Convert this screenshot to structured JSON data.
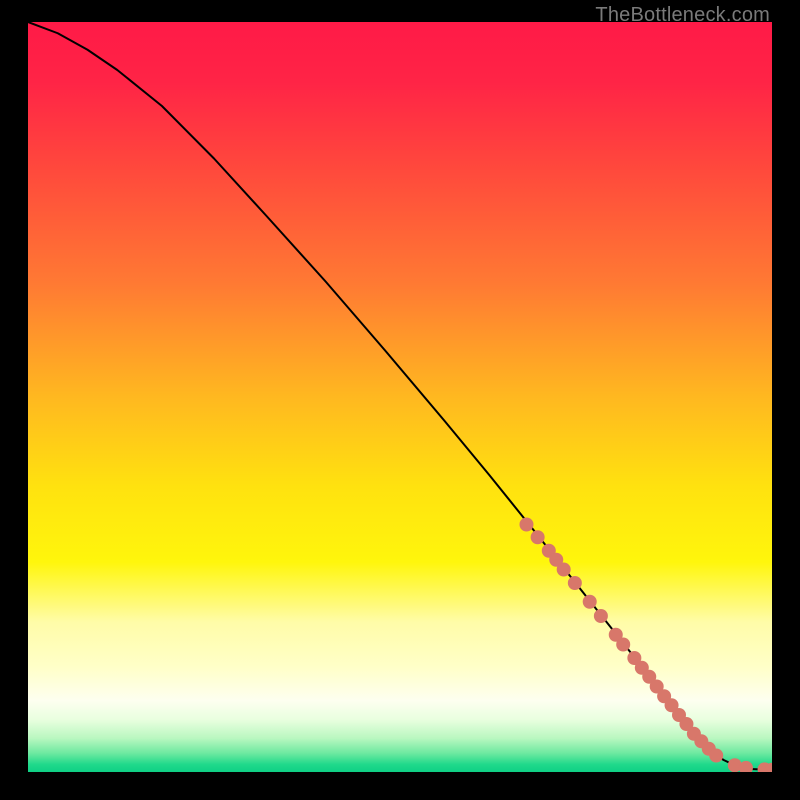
{
  "watermark": "TheBottleneck.com",
  "chart_data": {
    "type": "line",
    "title": "",
    "xlabel": "",
    "ylabel": "",
    "xlim": [
      0,
      100
    ],
    "ylim": [
      0,
      100
    ],
    "grid": false,
    "gradient_stops": [
      {
        "offset": 0.0,
        "color": "#ff1a47"
      },
      {
        "offset": 0.08,
        "color": "#ff2446"
      },
      {
        "offset": 0.2,
        "color": "#ff4a3c"
      },
      {
        "offset": 0.35,
        "color": "#ff7a33"
      },
      {
        "offset": 0.5,
        "color": "#ffb820"
      },
      {
        "offset": 0.62,
        "color": "#ffe20f"
      },
      {
        "offset": 0.72,
        "color": "#fff60c"
      },
      {
        "offset": 0.8,
        "color": "#fffca8"
      },
      {
        "offset": 0.86,
        "color": "#ffffc8"
      },
      {
        "offset": 0.905,
        "color": "#fdfff0"
      },
      {
        "offset": 0.93,
        "color": "#e9ffdf"
      },
      {
        "offset": 0.955,
        "color": "#b9f7c0"
      },
      {
        "offset": 0.975,
        "color": "#6de9a0"
      },
      {
        "offset": 0.99,
        "color": "#1fd98b"
      },
      {
        "offset": 1.0,
        "color": "#0fd085"
      }
    ],
    "series": [
      {
        "name": "curve",
        "type": "line",
        "x": [
          0,
          4,
          8,
          12,
          18,
          25,
          32,
          40,
          48,
          56,
          62,
          68,
          72,
          76,
          80,
          83,
          86,
          88,
          90,
          92,
          93.5,
          95,
          96,
          97,
          100
        ],
        "y": [
          100,
          98.5,
          96.3,
          93.6,
          88.8,
          81.8,
          74.2,
          65.4,
          56.2,
          46.8,
          39.6,
          32.2,
          27.2,
          22.2,
          17.2,
          13.4,
          9.6,
          7.1,
          4.6,
          2.6,
          1.6,
          0.9,
          0.55,
          0.4,
          0.3
        ],
        "color": "#000000",
        "stroke_width": 2
      },
      {
        "name": "points",
        "type": "scatter",
        "x": [
          67,
          68.5,
          70,
          71,
          72,
          73.5,
          75.5,
          77,
          79,
          80,
          81.5,
          82.5,
          83.5,
          84.5,
          85.5,
          86.5,
          87.5,
          88.5,
          89.5,
          90.5,
          91.5,
          92.5,
          95,
          96.5,
          99,
          100
        ],
        "y": [
          33.0,
          31.3,
          29.5,
          28.3,
          27.0,
          25.2,
          22.7,
          20.8,
          18.3,
          17.0,
          15.2,
          13.9,
          12.7,
          11.4,
          10.1,
          8.9,
          7.6,
          6.4,
          5.1,
          4.1,
          3.1,
          2.2,
          0.9,
          0.55,
          0.35,
          0.3
        ],
        "color": "#d8776a",
        "radius": 7
      }
    ]
  }
}
